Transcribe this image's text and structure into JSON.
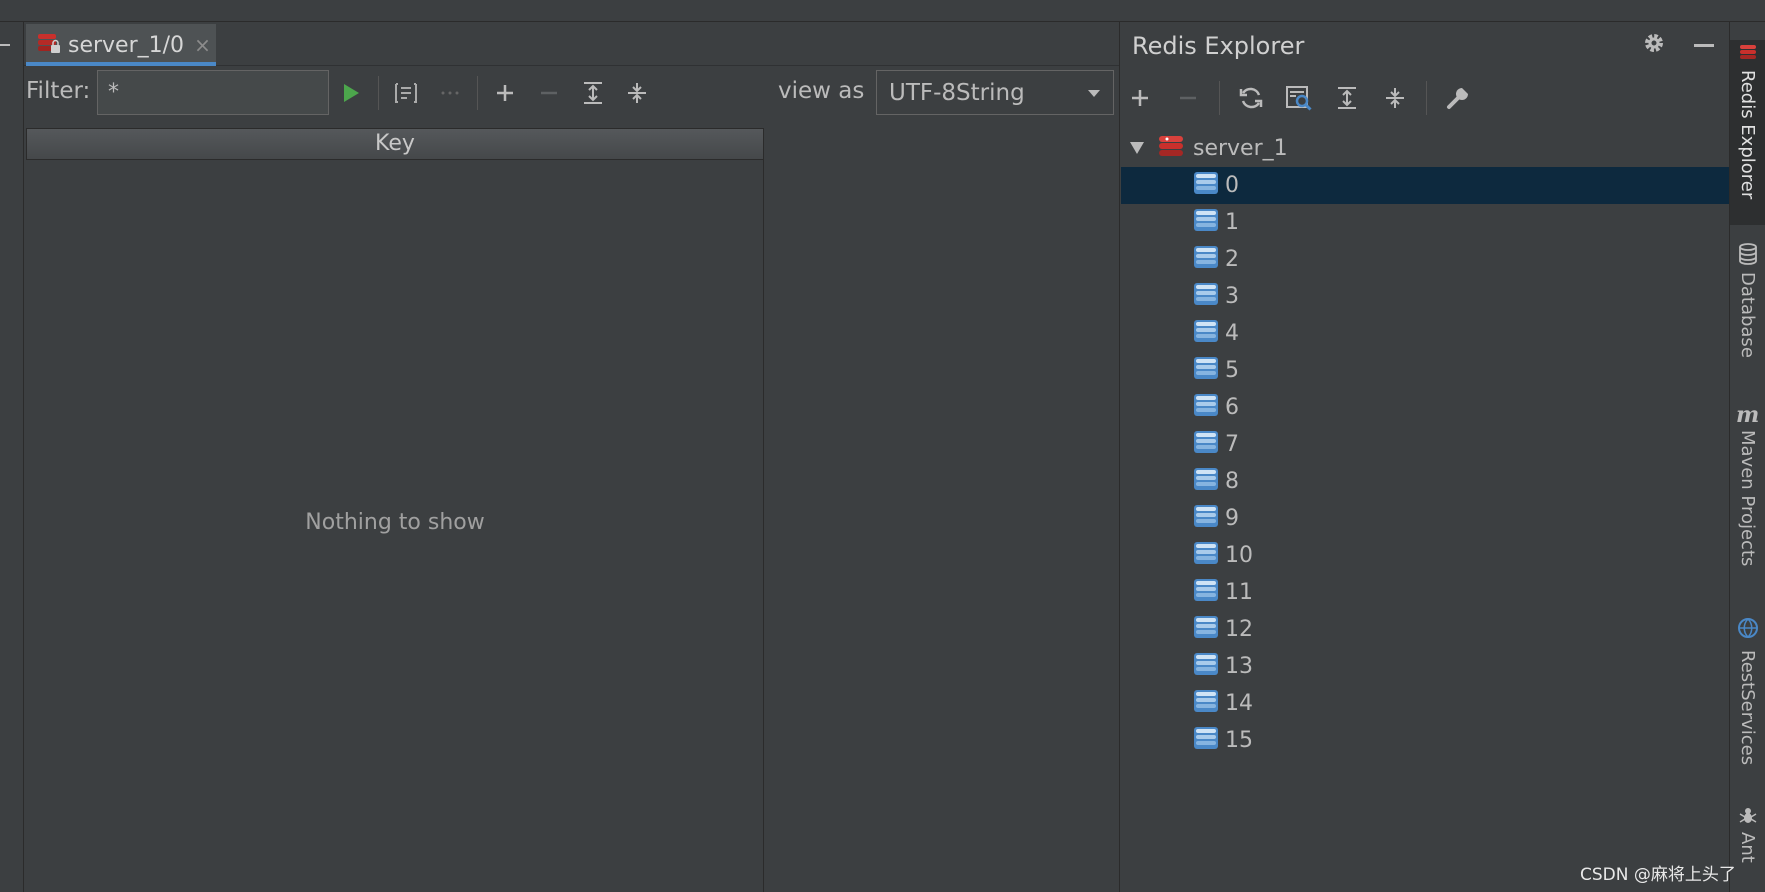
{
  "editor": {
    "tab_label": "server_1/0",
    "tab_close": "×",
    "filter_label": "Filter:",
    "filter_value": "*",
    "view_as_label": "view as",
    "view_as_value": "UTF-8String",
    "key_column": "Key",
    "empty_text": "Nothing to show"
  },
  "explorer": {
    "title": "Redis Explorer",
    "server_name": "server_1",
    "databases": [
      "0",
      "1",
      "2",
      "3",
      "4",
      "5",
      "6",
      "7",
      "8",
      "9",
      "10",
      "11",
      "12",
      "13",
      "14",
      "15"
    ],
    "selected_index": 0
  },
  "side_tools": {
    "redis_explorer": "Redis Explorer",
    "database": "Database",
    "maven": "Maven Projects",
    "rest": "RestServices",
    "ant": "Ant"
  },
  "watermark": "CSDN @麻将上头了",
  "colors": {
    "background": "#3c3f41",
    "selection": "#0d293e",
    "accent": "#4a88c7",
    "run_green": "#4ca64c",
    "redis_red": "#c9302c"
  }
}
